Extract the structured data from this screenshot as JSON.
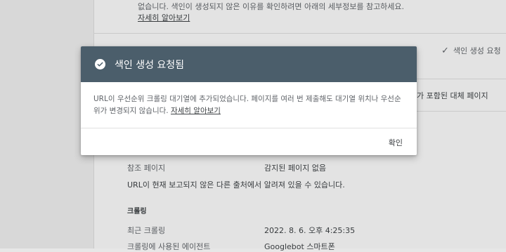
{
  "background": {
    "desc_line": "없습니다. 색인이 생성되지 않은 이유를 확인하려면 아래의 세부정보를 참고하세요.",
    "desc_link": "자세히 알아보기",
    "status": "색인 생성 요청",
    "right_row": "가 포함된 대체 페이지",
    "referring_label": "참조 페이지",
    "referring_value": "감지된 페이지 없음",
    "referring_note": "URL이 현재 보고되지 않은 다른 출처에서 알려져 있을 수 있습니다.",
    "crawl_section": "크롤링",
    "last_crawl_label": "최근 크롤링",
    "last_crawl_value": "2022. 8. 6. 오후 4:25:35",
    "crawl_agent_label": "크롤링에 사용된 에이전트",
    "crawl_agent_value": "Googlebot 스마트폰"
  },
  "dialog": {
    "title": "색인 생성 요청됨",
    "body": "URL이 우선순위 크롤링 대기열에 추가되었습니다. 페이지를 여러 번 제출해도 대기열 위치나 우선순위가 변경되지 않습니다.",
    "link": "자세히 알아보기",
    "ok_label": "확인"
  },
  "colors": {
    "header_bg": "#4b5e6b",
    "header_text": "#ffffff"
  },
  "icons": {
    "header": "check-circle-icon",
    "status": "check-icon"
  }
}
